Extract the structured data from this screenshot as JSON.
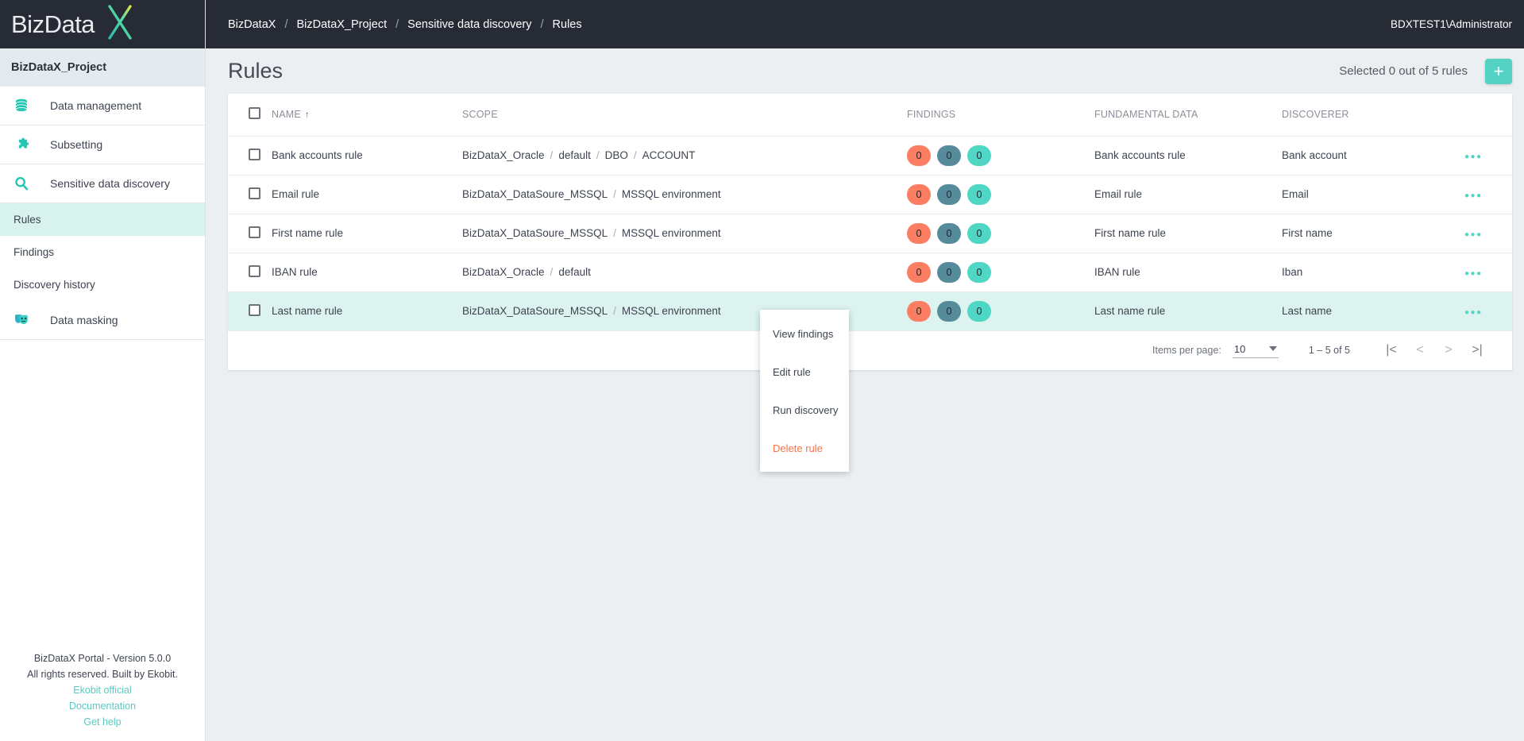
{
  "brand": {
    "logo_text": "BizData",
    "logo_mark": "X"
  },
  "topbar": {
    "breadcrumbs": [
      "BizDataX",
      "BizDataX_Project",
      "Sensitive data discovery",
      "Rules"
    ],
    "separator": "/",
    "user": "BDXTEST1\\Administrator"
  },
  "sidebar": {
    "project": "BizDataX_Project",
    "items": [
      {
        "label": "Data management",
        "icon": "database-icon"
      },
      {
        "label": "Subsetting",
        "icon": "puzzle-piece-icon"
      },
      {
        "label": "Sensitive data discovery",
        "icon": "magnifier-icon"
      }
    ],
    "subitems": [
      {
        "label": "Rules",
        "active": true
      },
      {
        "label": "Findings",
        "active": false
      },
      {
        "label": "Discovery history",
        "active": false
      }
    ],
    "items2": [
      {
        "label": "Data masking",
        "icon": "theater-masks-icon"
      }
    ],
    "footer": {
      "version": "BizDataX Portal - Version 5.0.0",
      "rights": "All rights reserved. Built by Ekobit.",
      "links": [
        "Ekobit official",
        "Documentation",
        "Get help"
      ]
    }
  },
  "page": {
    "title": "Rules",
    "selected_text": "Selected 0 out of 5 rules",
    "add_button": "+"
  },
  "table": {
    "columns": [
      "NAME",
      "SCOPE",
      "FINDINGS",
      "FUNDAMENTAL DATA",
      "DISCOVERER"
    ],
    "sort_column": "NAME",
    "sort_arrow": "↑",
    "rows": [
      {
        "name": "Bank accounts rule",
        "scope": [
          "BizDataX_Oracle",
          "default",
          "DBO",
          "ACCOUNT"
        ],
        "findings": [
          "0",
          "0",
          "0"
        ],
        "fundamental_data": "Bank accounts rule",
        "discoverer": "Bank account",
        "selected": false,
        "checked": false
      },
      {
        "name": "Email rule",
        "scope": [
          "BizDataX_DataSoure_MSSQL",
          "MSSQL environment"
        ],
        "findings": [
          "0",
          "0",
          "0"
        ],
        "fundamental_data": "Email rule",
        "discoverer": "Email",
        "selected": false,
        "checked": false
      },
      {
        "name": "First name rule",
        "scope": [
          "BizDataX_DataSoure_MSSQL",
          "MSSQL environment"
        ],
        "findings": [
          "0",
          "0",
          "0"
        ],
        "fundamental_data": "First name rule",
        "discoverer": "First name",
        "selected": false,
        "checked": false
      },
      {
        "name": "IBAN rule",
        "scope": [
          "BizDataX_Oracle",
          "default"
        ],
        "findings": [
          "0",
          "0",
          "0"
        ],
        "fundamental_data": "IBAN rule",
        "discoverer": "Iban",
        "selected": false,
        "checked": false
      },
      {
        "name": "Last name rule",
        "scope": [
          "BizDataX_DataSoure_MSSQL",
          "MSSQL environment"
        ],
        "findings": [
          "0",
          "0",
          "0"
        ],
        "fundamental_data": "Last name rule",
        "discoverer": "Last name",
        "selected": true,
        "checked": false
      }
    ]
  },
  "paginator": {
    "items_per_page_label": "Items per page:",
    "items_per_page_value": "10",
    "range": "1 – 5 of 5",
    "first_icon": "|<",
    "prev_icon": "<",
    "next_icon": ">",
    "last_icon": ">|"
  },
  "context_menu": {
    "items": [
      {
        "label": "View findings",
        "danger": false
      },
      {
        "label": "Edit rule",
        "danger": false
      },
      {
        "label": "Run discovery",
        "danger": false
      },
      {
        "label": "Delete rule",
        "danger": true
      }
    ]
  },
  "colors": {
    "accent_teal": "#4fd6c4",
    "badge_red": "#fb7d62",
    "badge_slate": "#568b9b",
    "badge_teal": "#4fd6c4",
    "danger": "#fb7043",
    "dark_nav": "#262b36",
    "row_selected": "#dcf3ef"
  }
}
